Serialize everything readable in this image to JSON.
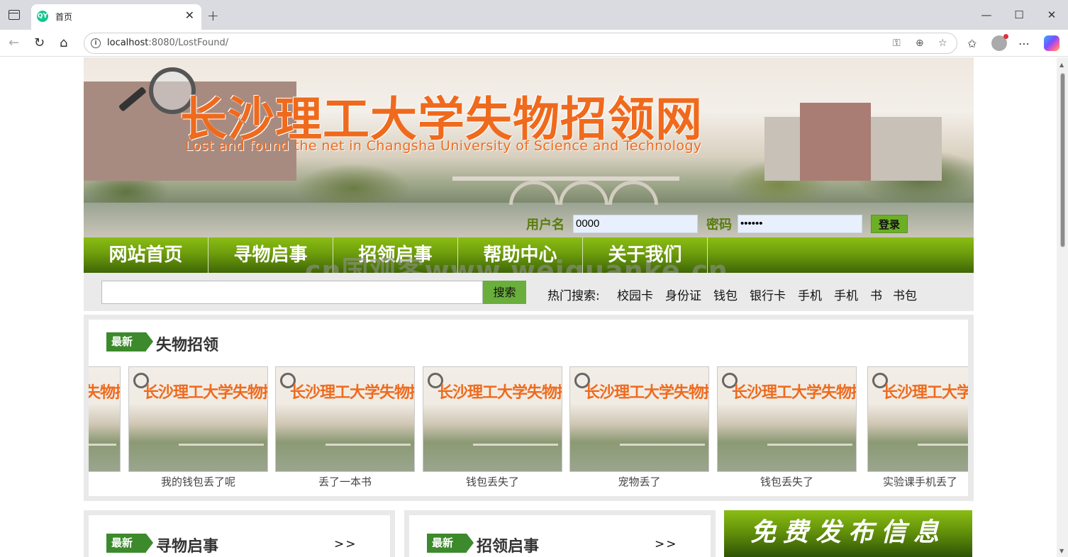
{
  "browser": {
    "tab_title": "首页",
    "favicon_text": "QY",
    "url_host": "localhost",
    "url_rest": ":8080/LostFound/",
    "icons": [
      "back-icon",
      "refresh-icon",
      "home-icon",
      "info-icon",
      "key-icon",
      "zoom-icon",
      "star-icon",
      "favorites-icon",
      "profile-icon",
      "more-icon",
      "copilot-icon"
    ]
  },
  "banner": {
    "title": "长沙理工大学失物招领网",
    "subtitle": "Lost and found the net in Changsha University of Science and Technology"
  },
  "login": {
    "username_label": "用户名",
    "username_value": "0000",
    "password_label": "密码",
    "password_value": "••••••",
    "submit_label": "登录"
  },
  "nav": {
    "items": [
      "网站首页",
      "寻物启事",
      "招领启事",
      "帮助中心",
      "关于我们"
    ]
  },
  "watermark": "cn国观客www.weiguanke.cn",
  "search": {
    "button_label": "搜索",
    "hot_label": "热门搜索:",
    "hot_items": [
      "校园卡",
      "身份证",
      "钱包",
      "银行卡",
      "手机",
      "手机",
      "书",
      "书包"
    ]
  },
  "latest": {
    "badge": "最新",
    "title": "失物招领",
    "thumb_title": "长沙理工大学失物招领网",
    "items": [
      {
        "caption": ""
      },
      {
        "caption": "我的钱包丢了呢"
      },
      {
        "caption": "丢了一本书"
      },
      {
        "caption": "钱包丢失了"
      },
      {
        "caption": "宠物丢了"
      },
      {
        "caption": "钱包丢失了"
      },
      {
        "caption": "实验课手机丢了"
      }
    ]
  },
  "panels": {
    "lost": {
      "badge": "最新",
      "title": "寻物启事",
      "more": ">>"
    },
    "found": {
      "badge": "最新",
      "title": "招领启事",
      "more": ">>"
    },
    "publish": "免费发布信息"
  }
}
